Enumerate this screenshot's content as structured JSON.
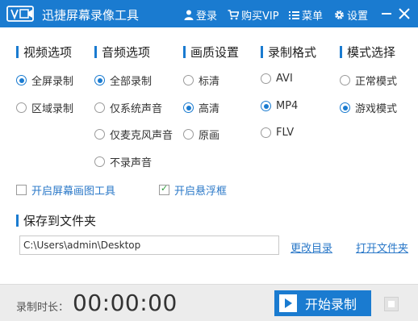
{
  "titlebar": {
    "app_title": "迅捷屏幕录像工具",
    "login": "登录",
    "buy_vip": "购买VIP",
    "menu": "菜单",
    "settings": "设置"
  },
  "groups": {
    "video": {
      "title": "视频选项",
      "options": [
        "全屏录制",
        "区域录制"
      ],
      "selected": "全屏录制"
    },
    "audio": {
      "title": "音频选项",
      "options": [
        "全部录制",
        "仅系统声音",
        "仅麦克风声音",
        "不录声音"
      ],
      "selected": "全部录制"
    },
    "quality": {
      "title": "画质设置",
      "options": [
        "标清",
        "高清",
        "原画"
      ],
      "selected": "高清"
    },
    "format": {
      "title": "录制格式",
      "options": [
        "AVI",
        "MP4",
        "FLV"
      ],
      "selected": "MP4"
    },
    "mode": {
      "title": "模式选择",
      "options": [
        "正常模式",
        "游戏模式"
      ],
      "selected": "游戏模式"
    }
  },
  "checkboxes": {
    "drawing_tool": {
      "label": "开启屏幕画图工具",
      "checked": false
    },
    "floating_window": {
      "label": "开启悬浮框",
      "checked": true
    }
  },
  "save": {
    "title": "保存到文件夹",
    "path": "C:\\Users\\admin\\Desktop",
    "change_dir": "更改目录",
    "open_folder": "打开文件夹"
  },
  "footer": {
    "duration_label": "录制时长：",
    "duration": "00:00:00",
    "start_label": "开始录制"
  },
  "colors": {
    "accent": "#1a7bd0",
    "link": "#2a78c8",
    "footer_bg": "#ececec"
  }
}
